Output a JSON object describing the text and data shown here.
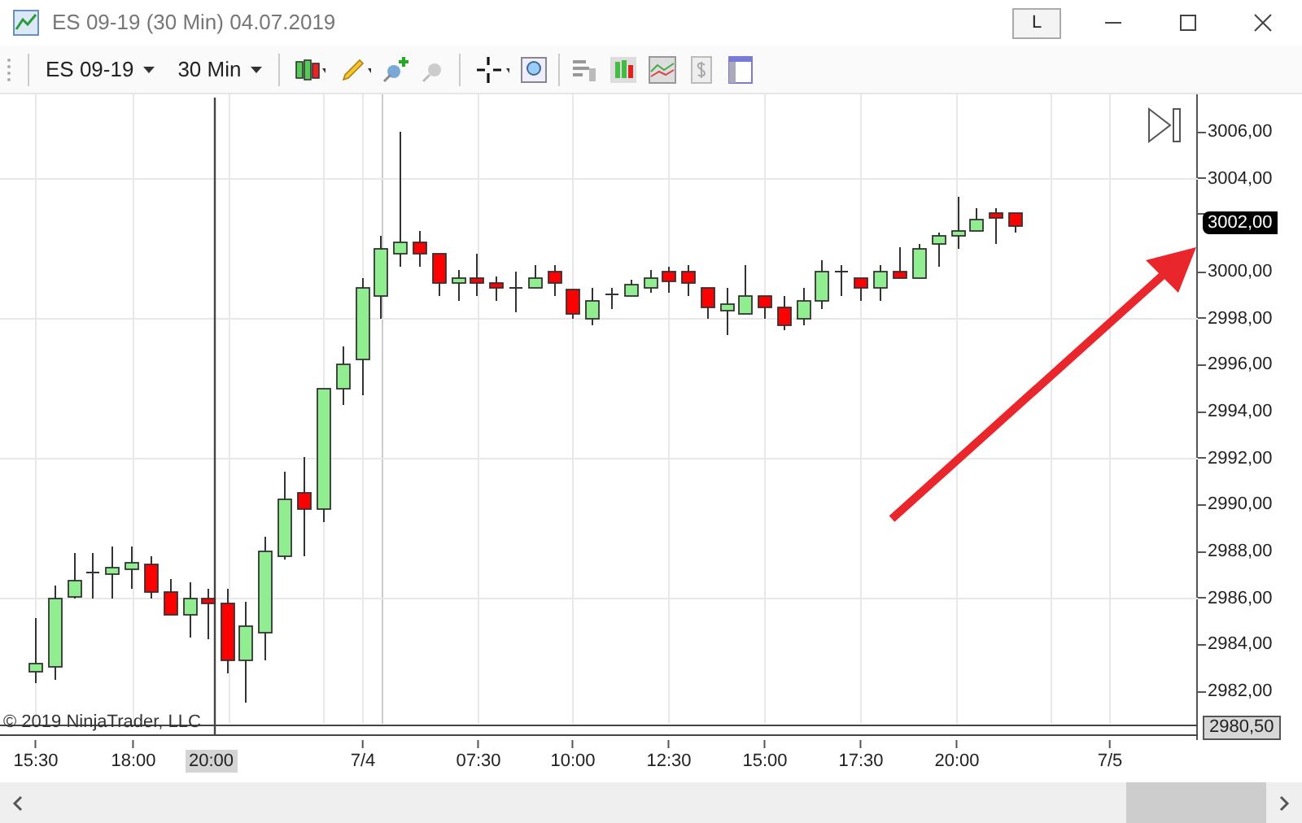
{
  "window": {
    "title": "ES 09-19 (30 Min)  04.07.2019",
    "button": "L"
  },
  "toolbar": {
    "instrument": "ES 09-19",
    "interval": "30 Min"
  },
  "chart": {
    "y_labels": [
      {
        "kind": "label",
        "text": "3006,00"
      },
      {
        "kind": "label",
        "text": "3004,00"
      },
      {
        "kind": "tick"
      },
      {
        "kind": "label",
        "text": "3000,00"
      },
      {
        "kind": "label",
        "text": "2998,00"
      },
      {
        "kind": "label",
        "text": "2996,00"
      },
      {
        "kind": "label",
        "text": "2994,00"
      },
      {
        "kind": "label",
        "text": "2992,00"
      },
      {
        "kind": "label",
        "text": "2990,00"
      },
      {
        "kind": "label",
        "text": "2988,00"
      },
      {
        "kind": "label",
        "text": "2986,00"
      },
      {
        "kind": "label",
        "text": "2984,00"
      },
      {
        "kind": "label",
        "text": "2982,00"
      }
    ],
    "current_price": "3002,00",
    "line_price": "2980,50",
    "copyright": "© 2019 NinjaTrader, LLC",
    "x_labels": [
      "15:30",
      "18:00",
      "7/4",
      "07:30",
      "10:00",
      "12:30",
      "15:00",
      "17:30",
      "20:00",
      "7/5"
    ],
    "crosshair_time": "20:00"
  }
}
